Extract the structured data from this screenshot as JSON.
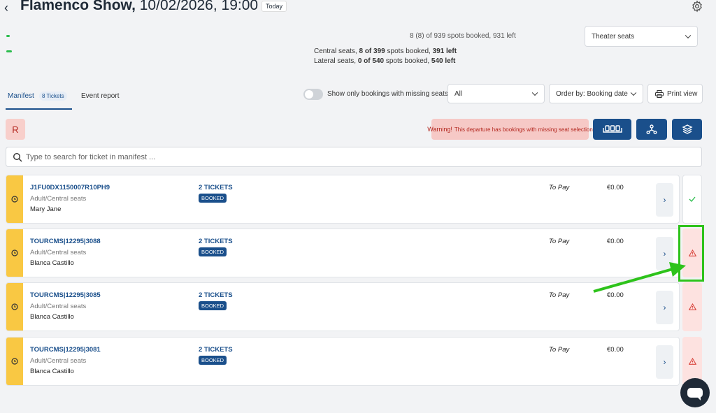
{
  "header": {
    "back_glyph": "‹",
    "title_bold": "Flamenco Show,",
    "title_rest": " 10/02/2026, 19:00",
    "today_badge": "Today"
  },
  "occupancy": {
    "total": "8 (8) of 939 spots booked, 931 left",
    "central_name": "Central seats",
    "central_booked": "8 of 399",
    "central_mid": " spots booked, ",
    "central_left": "391 left",
    "lateral_name": "Lateral seats",
    "lateral_booked": "0 of 540",
    "lateral_mid": " spots booked, ",
    "lateral_left": "540 left"
  },
  "seat_select": {
    "value": "Theater seats"
  },
  "tabs": {
    "manifest": "Manifest",
    "manifest_count": "8 Tickets",
    "event_report": "Event report"
  },
  "filters": {
    "missing_seats_label": "Show only bookings with missing seats",
    "missing_seats_on": false,
    "status_value": "All",
    "order_value": "Order by: Booking date",
    "print_label": "Print view"
  },
  "actions": {
    "r_label": "R",
    "warning_bold": "Warning!",
    "warning_text": "This departure has bookings with missing seat selection"
  },
  "search": {
    "placeholder": "Type to search for ticket in manifest ..."
  },
  "bookings": [
    {
      "ref": "J1FU0DX1150007R10PH9",
      "seat_type": "Adult/Central seats",
      "name": "Mary Jane",
      "tickets": "2 TICKETS",
      "status": "BOOKED",
      "pay_status": "To Pay",
      "amount": "€0.00",
      "seat_state": "ok"
    },
    {
      "ref": "TOURCMS|12295|3088",
      "seat_type": "Adult/Central seats",
      "name": "Blanca Castillo",
      "tickets": "2 TICKETS",
      "status": "BOOKED",
      "pay_status": "To Pay",
      "amount": "€0.00",
      "seat_state": "missing"
    },
    {
      "ref": "TOURCMS|12295|3085",
      "seat_type": "Adult/Central seats",
      "name": "Blanca Castillo",
      "tickets": "2 TICKETS",
      "status": "BOOKED",
      "pay_status": "To Pay",
      "amount": "€0.00",
      "seat_state": "missing"
    },
    {
      "ref": "TOURCMS|12295|3081",
      "seat_type": "Adult/Central seats",
      "name": "Blanca Castillo",
      "tickets": "2 TICKETS",
      "status": "BOOKED",
      "pay_status": "To Pay",
      "amount": "€0.00",
      "seat_state": "missing"
    }
  ],
  "colors": {
    "brand_blue": "#1a4f8b",
    "pending_stripe": "#f9c843",
    "warning_bg": "#f6c9c6",
    "annotation_green": "#2ec31b"
  }
}
